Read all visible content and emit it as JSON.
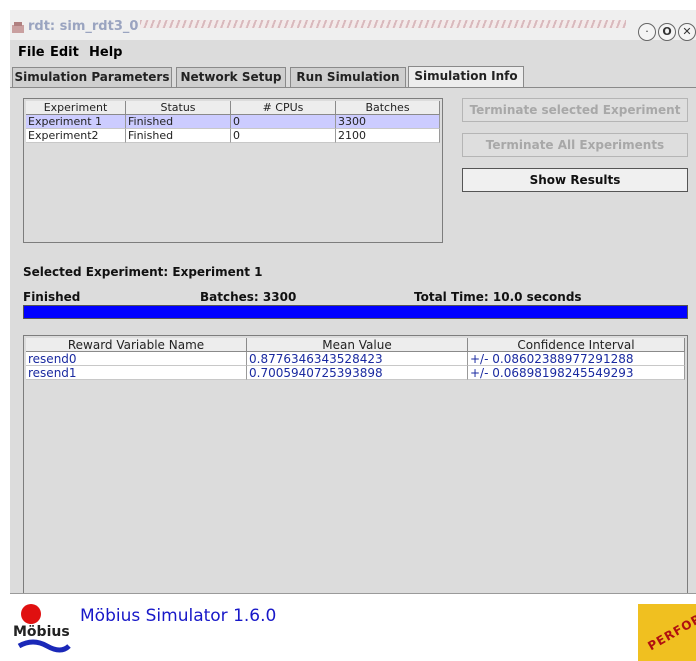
{
  "window": {
    "title": "rdt: sim_rdt3_0"
  },
  "menu": {
    "file": "File",
    "edit": "Edit",
    "help": "Help"
  },
  "tabs": [
    {
      "label": "Simulation Parameters",
      "active": false
    },
    {
      "label": "Network Setup",
      "active": false
    },
    {
      "label": "Run Simulation",
      "active": false
    },
    {
      "label": "Simulation Info",
      "active": true
    }
  ],
  "experiments": {
    "headers": [
      "Experiment",
      "Status",
      "# CPUs",
      "Batches"
    ],
    "rows": [
      [
        "Experiment 1",
        "Finished",
        "0",
        "3300"
      ],
      [
        "Experiment2",
        "Finished",
        "0",
        "2100"
      ]
    ],
    "selected_index": 0
  },
  "buttons": {
    "terminate_selected": "Terminate selected Experiment",
    "terminate_all": "Terminate All Experiments",
    "show_results": "Show Results"
  },
  "selected": {
    "heading": "Selected Experiment: Experiment 1",
    "status": "Finished",
    "batches": "Batches: 3300",
    "total_time": "Total Time: 10.0 seconds",
    "progress": 1.0
  },
  "results": {
    "headers": [
      "Reward Variable Name",
      "Mean Value",
      "Confidence Interval"
    ],
    "rows": [
      [
        "resend0",
        "0.8776346343528423",
        "+/- 0.08602388977291288"
      ],
      [
        "resend1",
        "0.7005940725393898",
        "+/- 0.06898198245549293"
      ]
    ]
  },
  "footer": {
    "product": "Möbius Simulator 1.6.0",
    "logo_word": "Möbius",
    "logo_right_text": "PERFORM"
  },
  "colors": {
    "progress_fill": "#0000ff",
    "selection": "#ccccff",
    "value_text": "#1a2aa0",
    "footer_text": "#1818c8"
  },
  "icons": [
    "app-icon",
    "minimize-icon",
    "maximize-icon",
    "close-icon",
    "mobius-logo-icon",
    "perform-logo-icon"
  ]
}
